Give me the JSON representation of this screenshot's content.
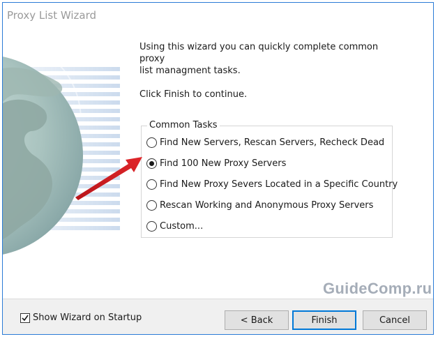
{
  "window": {
    "title": "Proxy List Wizard"
  },
  "intro": {
    "line1": "Using this wizard you can quickly complete common proxy",
    "line2": "list managment tasks.",
    "finish_hint": "Click Finish to continue."
  },
  "common_tasks": {
    "legend": "Common Tasks",
    "options": [
      {
        "label": "Find New Servers, Rescan Servers, Recheck Dead",
        "selected": false
      },
      {
        "label": "Find 100 New Proxy Servers",
        "selected": true
      },
      {
        "label": "Find New Proxy Severs Located in a Specific Country",
        "selected": false
      },
      {
        "label": "Rescan Working and Anonymous Proxy Servers",
        "selected": false
      },
      {
        "label": "Custom...",
        "selected": false
      }
    ]
  },
  "footer": {
    "show_wizard_label": "Show Wizard on Startup",
    "show_wizard_checked": true,
    "back_label": "< Back",
    "finish_label": "Finish",
    "cancel_label": "Cancel"
  },
  "watermark": "GuideComp.ru",
  "colors": {
    "window_border": "#2b7bd6",
    "annotation_arrow": "#e0262a",
    "watermark": "#a5adb8"
  }
}
